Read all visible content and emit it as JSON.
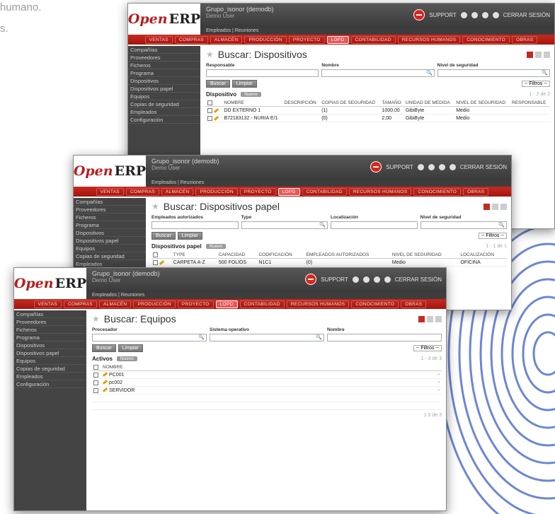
{
  "page_text": {
    "line1": "humano.",
    "line2": "s."
  },
  "colors": {
    "brand_red": "#c62a1f",
    "header_dark": "#3a3a3a"
  },
  "common": {
    "logo_open": "Open",
    "logo_erp": "ERP",
    "company": "Grupo_isonor (demodb)",
    "user": "Demo User",
    "support": "SUPPORT",
    "logout": "CERRAR SESIÓN",
    "shortcuts": "Empleados | Reuniones",
    "menu": [
      "VENTAS",
      "COMPRAS",
      "ALMACÉN",
      "PRODUCCIÓN",
      "PROYECTO",
      "LOPD",
      "CONTABILIDAD",
      "RECURSOS HUMANOS",
      "CONOCIMIENTO",
      "OBRAS"
    ],
    "sidebar": [
      "Compañías",
      "Proveedores",
      "Ficheros",
      "Programa",
      "Dispositivos",
      "Dispositivos papel",
      "Equipos",
      "Copias de seguridad",
      "Empleados",
      "Configuración"
    ],
    "search_btn": "Buscar",
    "clear_btn": "Limpiar",
    "filters": "-- Filtros --",
    "new_btn": "Nuevo"
  },
  "w1": {
    "title": "Buscar: Dispositivos",
    "fields": [
      "Responsable",
      "Nombre",
      "Nivel de seguridad"
    ],
    "list_title": "Dispositivo",
    "pager": "1 - 2 de 2",
    "columns": [
      "NOMBRE",
      "DESCRIPCIÓN",
      "COPIAS DE SEGURIDAD",
      "TAMAÑO",
      "UNIDAD DE MEDIDA",
      "NIVEL DE SEGURIDAD",
      "RESPONSABLE"
    ],
    "rows": [
      [
        "DD EXTERNO 1",
        "",
        "(1)",
        "1000,00",
        "GibiByte",
        "Medio",
        ""
      ],
      [
        "B72183132 - NURIA E/1",
        "",
        "(0)",
        "2,00",
        "GibiByte",
        "Medio",
        ""
      ]
    ]
  },
  "w2": {
    "title": "Buscar: Dispositivos papel",
    "fields": [
      "Empleados autorizados",
      "Type",
      "Localización",
      "Nivel de seguridad"
    ],
    "list_title": "Dispositivos papel",
    "pager": "1 - 1 de 1",
    "columns": [
      "TYPE",
      "CAPACIDAD",
      "CODIFICACIÓN",
      "EMPLEADOS AUTORIZADOS",
      "NIVEL DE SEGURIDAD",
      "LOCALIZACIÓN"
    ],
    "rows": [
      [
        "CARPETA A-Z",
        "500 FOLIOS",
        "N1C1",
        "(0)",
        "Medio",
        "OFICINA"
      ]
    ]
  },
  "w3": {
    "title": "Buscar: Equipos",
    "fields": [
      "Procesador",
      "Sistema operativo",
      "Nombre"
    ],
    "list_title": "Activos",
    "pager": "1 - 3 de 3",
    "columns": [
      "NOMBRE"
    ],
    "rows": [
      [
        "PC001"
      ],
      [
        "pc002"
      ],
      [
        "SERVIDOR"
      ]
    ],
    "footer_pager": "1 3 de 3"
  }
}
